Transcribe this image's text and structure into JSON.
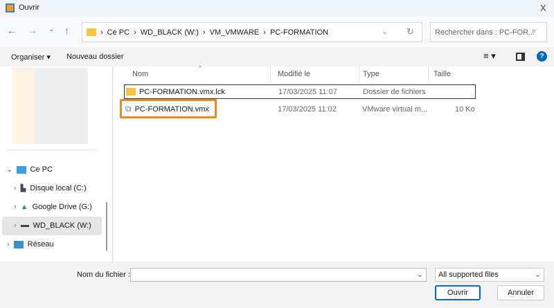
{
  "window": {
    "title": "Ouvrir",
    "close": "X"
  },
  "address": {
    "segments": [
      "Ce PC",
      "WD_BLACK (W:)",
      "VM_VMWARE",
      "PC-FORMATION"
    ],
    "separator": "›"
  },
  "search": {
    "placeholder": "Rechercher dans : PC-FOR..."
  },
  "toolbar": {
    "organize": "Organiser ▾",
    "new_folder": "Nouveau dossier"
  },
  "sidebar": {
    "items": [
      {
        "label": "Ce PC"
      },
      {
        "label": "Disque local (C:)"
      },
      {
        "label": "Google Drive (G:)"
      },
      {
        "label": "WD_BLACK (W:)"
      },
      {
        "label": "Réseau"
      }
    ]
  },
  "columns": {
    "name": "Nom",
    "modified": "Modifié le",
    "type": "Type",
    "size": "Taille"
  },
  "files": [
    {
      "name": "PC-FORMATION.vmx.lck",
      "modified": "17/03/2025 11:07",
      "type": "Dossier de fichiers",
      "size": ""
    },
    {
      "name": "PC-FORMATION.vmx",
      "modified": "17/03/2025 11:02",
      "type": "VMware virtual m...",
      "size": "10 Ko"
    }
  ],
  "footer": {
    "filename_label": "Nom du fichier :",
    "filename_value": "",
    "filter": "All supported files",
    "open": "Ouvrir",
    "cancel": "Annuler"
  },
  "colors": {
    "highlight": "#f08a24",
    "accent": "#0067c0"
  }
}
